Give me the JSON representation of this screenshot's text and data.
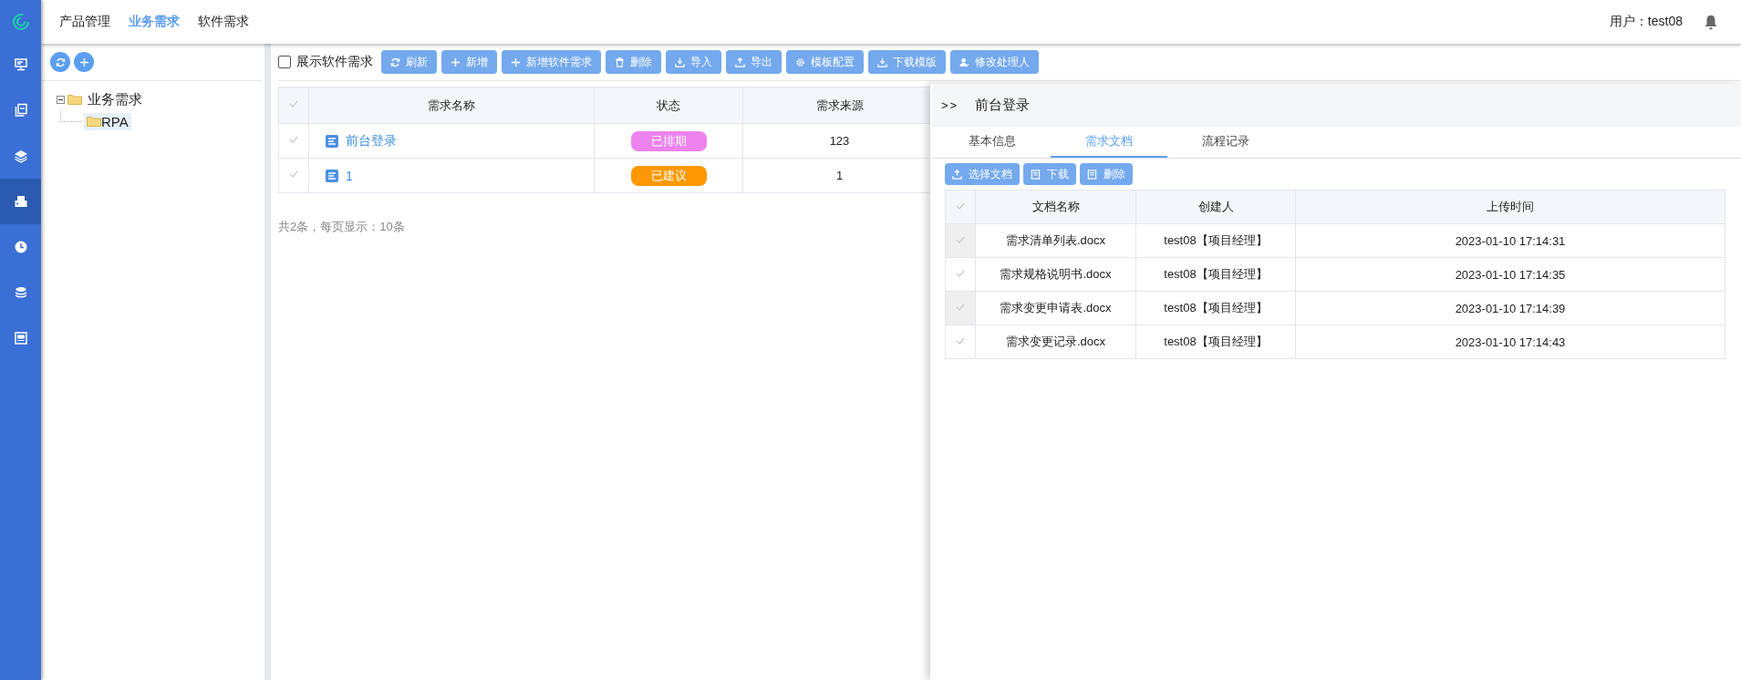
{
  "top_nav": [
    {
      "label": "产品管理",
      "selected": false
    },
    {
      "label": "业务需求",
      "selected": true
    },
    {
      "label": "软件需求",
      "selected": false
    }
  ],
  "user": {
    "label": "用户：test08"
  },
  "rail": [
    {
      "selected": false
    },
    {
      "selected": false
    },
    {
      "selected": false
    },
    {
      "selected": true
    },
    {
      "selected": false
    },
    {
      "selected": false
    },
    {
      "selected": false
    }
  ],
  "tree": [
    {
      "label": "业务需求",
      "expanded": true,
      "selected": false,
      "children": [
        {
          "label": "RPA",
          "selected": true
        }
      ]
    }
  ],
  "toolbar": {
    "checkbox": {
      "label": "展示软件需求",
      "checked": false
    },
    "buttons": [
      "刷新",
      "新增",
      "新增软件需求",
      "删除",
      "导入",
      "导出",
      "模板配置",
      "下载模版",
      "修改处理人"
    ]
  },
  "table": {
    "columns": [
      "需求名称",
      "状态",
      "需求来源"
    ],
    "rows": [
      {
        "name": "前台登录",
        "status": "已排期",
        "color": "#ee82ee",
        "source": "123"
      },
      {
        "name": "1",
        "status": "已建议",
        "color": "#ff9800",
        "source": "1"
      }
    ]
  },
  "pagination": "共2条，每页显示：10条",
  "detail": {
    "toggle": ">>",
    "title": "前台登录",
    "tabs": [
      {
        "label": "基本信息",
        "selected": false
      },
      {
        "label": "需求文档",
        "selected": true
      },
      {
        "label": "流程记录",
        "selected": false
      }
    ],
    "buttons": [
      "选择文档",
      "下载",
      "删除"
    ],
    "columns": [
      "文档名称",
      "创建人",
      "上传时间"
    ],
    "rows": [
      {
        "name": "需求清单列表.docx",
        "creator": "test08【项目经理】",
        "time": "2023-01-10 17:14:31"
      },
      {
        "name": "需求规格说明书.docx",
        "creator": "test08【项目经理】",
        "time": "2023-01-10 17:14:35"
      },
      {
        "name": "需求变更申请表.docx",
        "creator": "test08【项目经理】",
        "time": "2023-01-10 17:14:39"
      },
      {
        "name": "需求变更记录.docx",
        "creator": "test08【项目经理】",
        "time": "2023-01-10 17:14:43"
      }
    ]
  }
}
